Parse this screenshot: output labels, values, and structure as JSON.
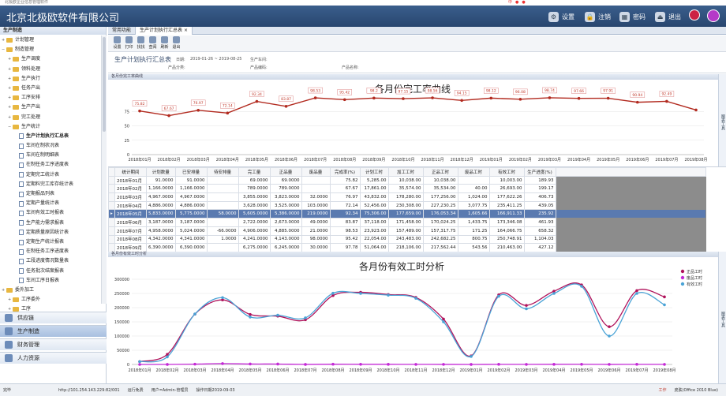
{
  "window_title": "北极欧企业信息管理软件",
  "app": {
    "brand": "北京北极欧软件有限公司"
  },
  "topbar": {
    "settings": "设置",
    "logout_session": "注销",
    "password": "密码",
    "exit": "退出"
  },
  "tray": {
    "item": "中"
  },
  "sidebar": {
    "header": "生产制造",
    "tree": [
      {
        "label": "计划管理",
        "level": 1,
        "type": "folder",
        "expander": "+"
      },
      {
        "label": "制造管理",
        "level": 1,
        "type": "folder",
        "expander": "−"
      },
      {
        "label": "生产调度",
        "level": 2,
        "type": "folder",
        "expander": "+"
      },
      {
        "label": "领料处理",
        "level": 2,
        "type": "folder",
        "expander": "+"
      },
      {
        "label": "生产执行",
        "level": 2,
        "type": "folder",
        "expander": "+"
      },
      {
        "label": "任务产出",
        "level": 2,
        "type": "folder",
        "expander": "+"
      },
      {
        "label": "工序安排",
        "level": 2,
        "type": "folder",
        "expander": "+"
      },
      {
        "label": "生产产出",
        "level": 2,
        "type": "folder",
        "expander": "+"
      },
      {
        "label": "完工处理",
        "level": 2,
        "type": "folder",
        "expander": "+"
      },
      {
        "label": "生产统计",
        "level": 2,
        "type": "folder",
        "expander": "−"
      },
      {
        "label": "生产计划执行汇总表",
        "level": 3,
        "type": "doc",
        "selected": true
      },
      {
        "label": "车间在制状况表",
        "level": 3,
        "type": "doc"
      },
      {
        "label": "车间在制明细表",
        "level": 3,
        "type": "doc"
      },
      {
        "label": "在制任务工序进度表",
        "level": 3,
        "type": "doc"
      },
      {
        "label": "定期完工统计表",
        "level": 3,
        "type": "doc"
      },
      {
        "label": "定期料完工库存统计表",
        "level": 3,
        "type": "doc"
      },
      {
        "label": "定期报品列表",
        "level": 3,
        "type": "doc"
      },
      {
        "label": "定期产量统计表",
        "level": 3,
        "type": "doc"
      },
      {
        "label": "车间有效工时报表",
        "level": 3,
        "type": "doc"
      },
      {
        "label": "生产能力需求报表",
        "level": 3,
        "type": "doc"
      },
      {
        "label": "定期质量原因统计表",
        "level": 3,
        "type": "doc"
      },
      {
        "label": "定期生产统计报表",
        "level": 3,
        "type": "doc"
      },
      {
        "label": "在制任务工序进度表",
        "level": 3,
        "type": "doc"
      },
      {
        "label": "工段进度情况数量表",
        "level": 3,
        "type": "doc"
      },
      {
        "label": "任务批次结案报表",
        "level": 3,
        "type": "doc"
      },
      {
        "label": "车间工序日报表",
        "level": 3,
        "type": "doc"
      },
      {
        "label": "委外加工",
        "level": 1,
        "type": "folder",
        "expander": "+"
      },
      {
        "label": "工序委外",
        "level": 2,
        "type": "folder",
        "expander": "+"
      },
      {
        "label": "工序",
        "level": 2,
        "type": "folder",
        "expander": "+"
      }
    ],
    "accordion": [
      "供应链",
      "生产制造",
      "财务管理",
      "人力资源"
    ],
    "accordion_active": 1
  },
  "tabs": [
    {
      "label": "常用功能"
    },
    {
      "label": "生产计划执行汇总表"
    }
  ],
  "toolbar": [
    "设置",
    "打印",
    "找找",
    "查阅",
    "刷新",
    "退出"
  ],
  "report": {
    "title": "生产计划执行汇总表",
    "date_label": "日期:",
    "date_value": "2019-01-26 ~ 2019-08-25",
    "workshop_label": "生产车间:",
    "category_label": "产品分类:",
    "code_label": "产品编码:",
    "name_label": "产品名称:"
  },
  "completion_panel": {
    "header": "各月份完工率曲线",
    "side_caption": "图表工具"
  },
  "hours_panel": {
    "header": "各月份有效工时分析",
    "side_caption": "图表工具"
  },
  "grid": {
    "columns": [
      "统计期间",
      "计划数量",
      "已安排量",
      "待安排量",
      "完工量",
      "正品量",
      "废品量",
      "完成率(%)",
      "计划工时",
      "加工工时",
      "正品工时",
      "废品工时",
      "有效工时",
      "生产进度(%)"
    ],
    "rows": [
      [
        "2018年01月",
        "91.0000",
        "91.0000",
        "",
        "69.0000",
        "69.0000",
        "",
        "75.82",
        "5,285.00",
        "10,038.00",
        "10,038.00",
        "",
        "10,003.00",
        "189.93"
      ],
      [
        "2018年02月",
        "1,166.0000",
        "1,166.0000",
        "",
        "789.0000",
        "789.0000",
        "",
        "67.67",
        "17,861.00",
        "35,574.00",
        "35,534.00",
        "40.00",
        "26,693.00",
        "199.17"
      ],
      [
        "2018年03月",
        "4,967.0000",
        "4,967.0000",
        "",
        "3,855.0000",
        "3,823.0000",
        "32.0000",
        "76.97",
        "43,832.00",
        "178,280.00",
        "177,256.00",
        "1,024.00",
        "177,622.26",
        "406.73"
      ],
      [
        "2018年04月",
        "4,886.0000",
        "4,886.0000",
        "",
        "3,628.0000",
        "3,525.0000",
        "103.0000",
        "72.14",
        "52,456.00",
        "230,308.00",
        "227,230.25",
        "3,077.75",
        "235,411.25",
        "439.05"
      ],
      [
        "2018年05月",
        "5,833.0000",
        "5,775.0000",
        "58.0000",
        "5,605.0000",
        "5,386.0000",
        "219.0000",
        "92.34",
        "75,306.00",
        "177,659.00",
        "176,053.34",
        "1,605.66",
        "166,911.33",
        "235.92"
      ],
      [
        "2018年06月",
        "3,187.0000",
        "3,187.0000",
        "",
        "2,722.0000",
        "2,673.0000",
        "49.0000",
        "83.87",
        "37,118.00",
        "171,458.00",
        "170,024.25",
        "1,433.75",
        "173,346.08",
        "461.93"
      ],
      [
        "2018年07月",
        "4,958.0000",
        "5,024.0000",
        "-66.0000",
        "4,906.0000",
        "4,885.0000",
        "21.0000",
        "98.53",
        "23,923.00",
        "157,489.00",
        "157,317.75",
        "171.25",
        "164,066.75",
        "658.32"
      ],
      [
        "2018年08月",
        "4,342.0000",
        "4,341.0000",
        "1.0000",
        "4,241.0000",
        "4,143.0000",
        "98.0000",
        "95.42",
        "22,054.00",
        "243,483.00",
        "242,682.25",
        "800.75",
        "250,748.91",
        "1,104.03"
      ],
      [
        "2018年09月",
        "6,390.0000",
        "6,390.0000",
        "",
        "6,275.0000",
        "6,245.0000",
        "30.0000",
        "97.78",
        "51,064.00",
        "218,106.00",
        "217,562.44",
        "543.56",
        "210,463.00",
        "427.12"
      ]
    ],
    "selected_row": 4
  },
  "status": {
    "left": "完毕",
    "url": "http://101.254.143.229:82/001",
    "state": "运行免费",
    "user": "用户=Admin-管理员",
    "oper_date": "操作日期2019-09-03",
    "skin": "皮肤(Office 2010 Blue)",
    "work": "工作"
  },
  "chart_data": [
    {
      "type": "line",
      "title": "各月份完工率曲线",
      "categories": [
        "2018年01月",
        "2018年02月",
        "2018年03月",
        "2018年04月",
        "2018年05月",
        "2018年06月",
        "2018年07月",
        "2018年08月",
        "2018年09月",
        "2018年10月",
        "2018年11月",
        "2018年12月",
        "2019年01月",
        "2019年02月",
        "2019年03月",
        "2019年04月",
        "2019年05月",
        "2019年06月",
        "2019年07月",
        "2019年08月"
      ],
      "series": [
        {
          "name": "完成率",
          "color": "#b22a1f",
          "values": [
            75.82,
            67.67,
            76.97,
            72.14,
            92.34,
            83.87,
            98.53,
            95.42,
            98.2,
            97.15,
            98.56,
            94.15,
            98.12,
            96.08,
            98.74,
            97.66,
            97.91,
            90.94,
            92.49,
            77.5
          ]
        }
      ],
      "data_labels": [
        "75.82",
        "67.67",
        "76.97",
        "72.14",
        "92.34",
        "83.87",
        "98.53",
        "95.42",
        "98.2",
        "97.15",
        "98.56",
        "94.15",
        "98.12",
        "96.08",
        "98.74",
        "97.66",
        "97.91",
        "90.94",
        "92.49",
        ""
      ],
      "ylim": [
        0,
        100
      ],
      "yticks": [
        "0",
        "25",
        "50",
        "75"
      ],
      "grid": true
    },
    {
      "type": "line",
      "title": "各月份有效工时分析",
      "categories": [
        "2018年01月",
        "2018年02月",
        "2018年03月",
        "2018年04月",
        "2018年05月",
        "2018年06月",
        "2018年07月",
        "2018年08月",
        "2018年09月",
        "2018年10月",
        "2018年11月",
        "2018年12月",
        "2019年01月",
        "2019年02月",
        "2019年03月",
        "2019年04月",
        "2019年05月",
        "2019年06月",
        "2019年07月",
        "2019年08月"
      ],
      "series": [
        {
          "name": "正品工时",
          "color": "#b0135b",
          "values": [
            10038,
            35534,
            177256,
            227230,
            176053,
            170024,
            157318,
            242682,
            254000,
            246000,
            236000,
            160000,
            30000,
            245000,
            208000,
            258000,
            280000,
            133000,
            260000,
            238000
          ]
        },
        {
          "name": "废品工时",
          "color": "#c42ad6",
          "values": [
            0,
            40,
            1024,
            3078,
            1606,
            1434,
            171,
            801,
            544,
            500,
            300,
            200,
            50,
            400,
            300,
            500,
            600,
            200,
            400,
            300
          ]
        },
        {
          "name": "有效工时",
          "color": "#4aa3d6",
          "values": [
            10003,
            26693,
            177622,
            235411,
            166911,
            173346,
            164067,
            250749,
            250000,
            244000,
            233000,
            150000,
            28000,
            240000,
            196000,
            250000,
            275000,
            100000,
            250000,
            210000
          ]
        }
      ],
      "ylim": [
        0,
        300000
      ],
      "yticks": [
        "0",
        "50000",
        "100000",
        "150000",
        "200000",
        "250000",
        "300000"
      ],
      "legend": "right",
      "grid": true
    }
  ]
}
